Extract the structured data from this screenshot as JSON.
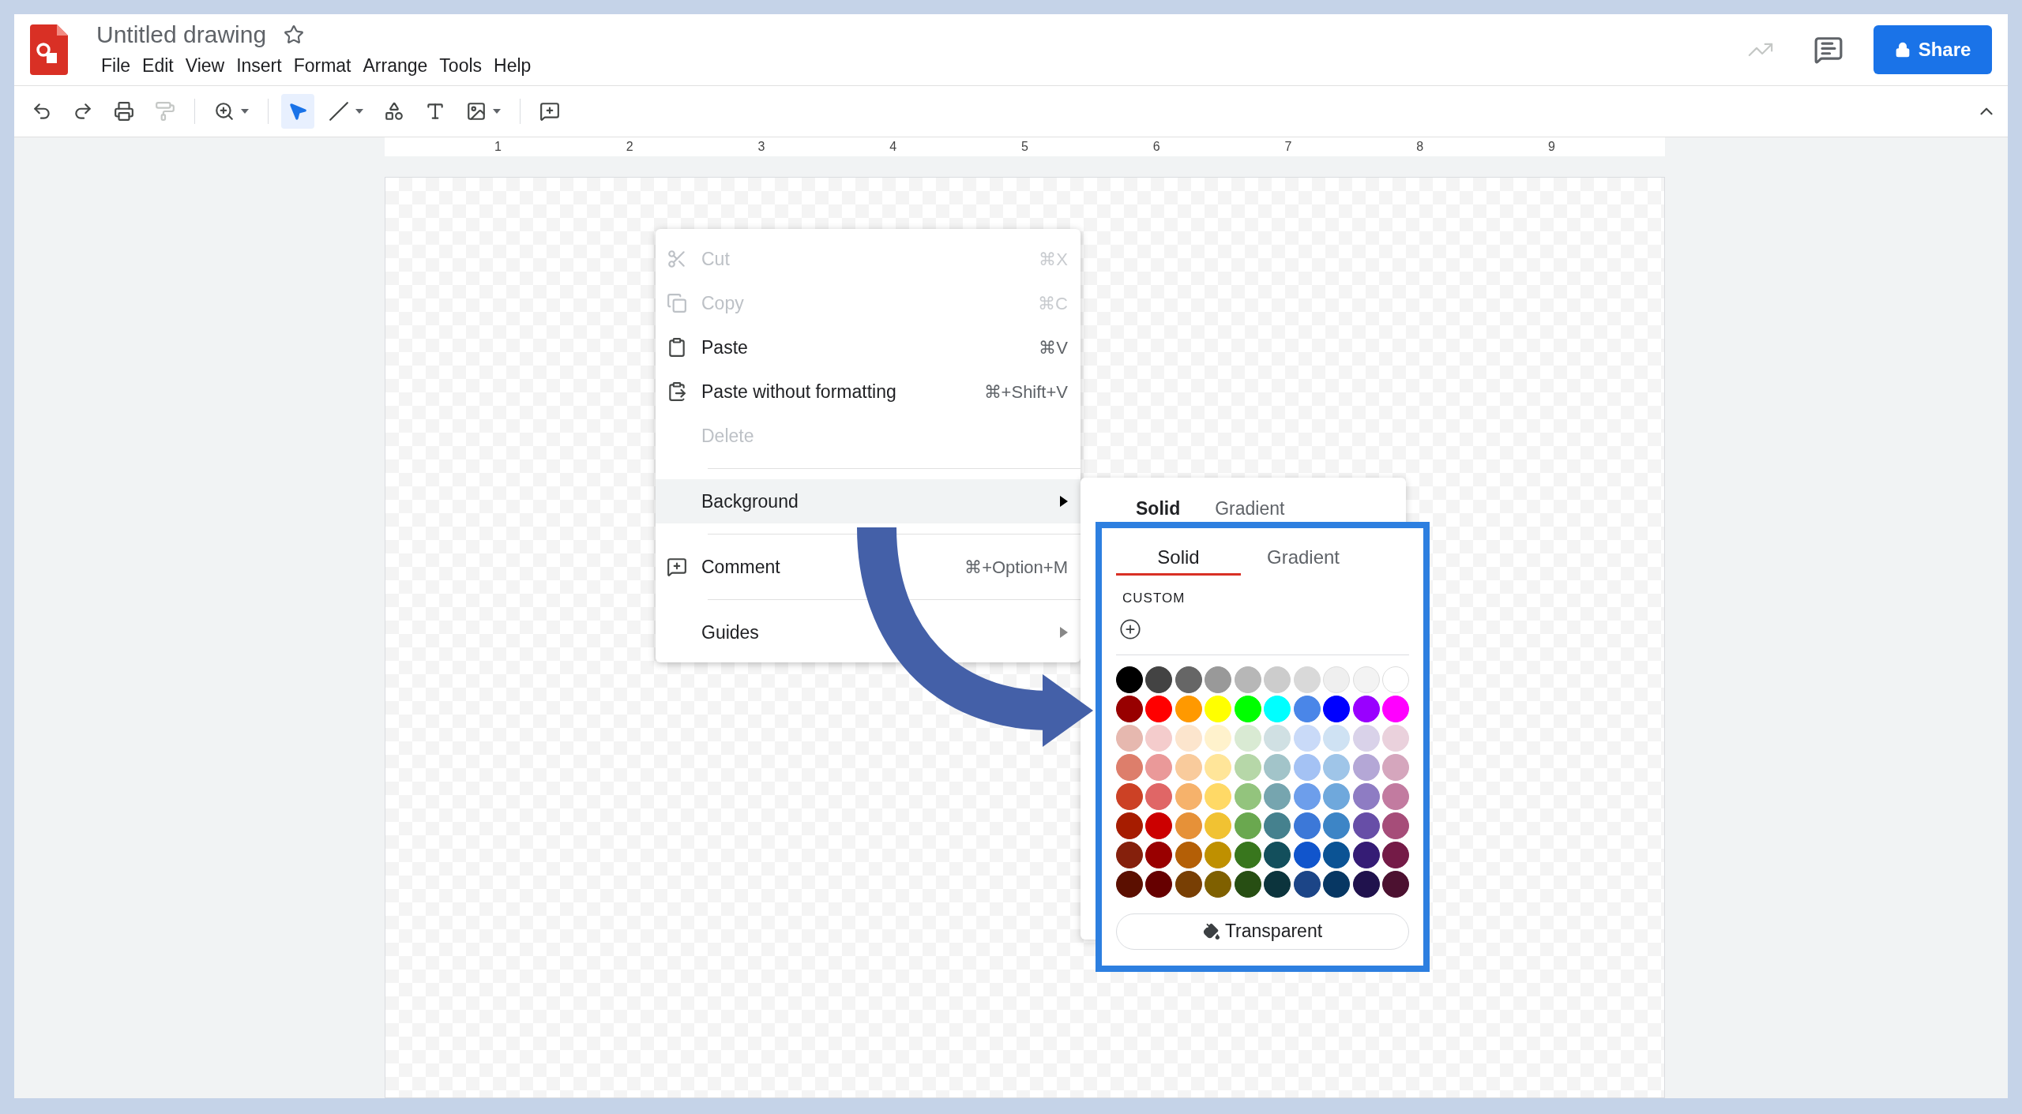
{
  "app": {
    "title": "Untitled drawing",
    "starred": false
  },
  "menu": [
    "File",
    "Edit",
    "View",
    "Insert",
    "Format",
    "Arrange",
    "Tools",
    "Help"
  ],
  "share_button": "Share",
  "toolbar_tools": [
    {
      "selected": false,
      "disabled": false
    },
    {
      "selected": false,
      "disabled": false
    },
    {
      "selected": false,
      "disabled": false
    },
    {
      "selected": false,
      "disabled": true
    },
    {
      "selected": false,
      "disabled": false
    },
    {
      "selected": true,
      "disabled": false
    },
    {
      "selected": false,
      "disabled": false
    },
    {
      "selected": false,
      "disabled": false
    },
    {
      "selected": false,
      "disabled": false
    },
    {
      "selected": false,
      "disabled": false
    },
    {
      "selected": false,
      "disabled": false
    }
  ],
  "ruler": [
    "1",
    "2",
    "3",
    "4",
    "5",
    "6",
    "7",
    "8",
    "9"
  ],
  "context_menu": {
    "items": [
      {
        "label": "Cut",
        "shortcut": "⌘X",
        "disabled": true,
        "selected": false,
        "submenu": false,
        "separator_above": false
      },
      {
        "label": "Copy",
        "shortcut": "⌘C",
        "disabled": true,
        "selected": false,
        "submenu": false,
        "separator_above": false
      },
      {
        "label": "Paste",
        "shortcut": "⌘V",
        "disabled": false,
        "selected": false,
        "submenu": false,
        "separator_above": false
      },
      {
        "label": "Paste without formatting",
        "shortcut": "⌘+Shift+V",
        "disabled": false,
        "selected": false,
        "submenu": false,
        "separator_above": false
      },
      {
        "label": "Delete",
        "disabled": true,
        "selected": false,
        "submenu": false,
        "separator_above": false
      },
      {
        "label": "Background",
        "disabled": false,
        "selected": true,
        "submenu": true,
        "separator_above": true
      },
      {
        "label": "Comment",
        "shortcut": "⌘+Option+M",
        "disabled": false,
        "selected": false,
        "submenu": false,
        "separator_above": true
      },
      {
        "label": "Guides",
        "disabled": false,
        "selected": false,
        "submenu": true,
        "separator_above": true
      }
    ]
  },
  "background_submenu": {
    "tabs": [
      {
        "label": "Solid",
        "selected": true
      },
      {
        "label": "Gradient",
        "selected": false
      }
    ]
  },
  "palette_zoom": {
    "tabs": [
      {
        "label": "Solid",
        "selected": true
      },
      {
        "label": "Gradient",
        "selected": false
      }
    ],
    "custom_label": "CUSTOM",
    "swatch_rows": [
      [
        {
          "color": "#000000"
        },
        {
          "color": "#434343"
        },
        {
          "color": "#666666"
        },
        {
          "color": "#999999"
        },
        {
          "color": "#b7b7b7"
        },
        {
          "color": "#cccccc"
        },
        {
          "color": "#d9d9d9"
        },
        {
          "color": "#efefef"
        },
        {
          "color": "#f3f3f3"
        },
        {
          "color": "#ffffff"
        }
      ],
      [
        {
          "color": "#980000"
        },
        {
          "color": "#ff0000"
        },
        {
          "color": "#ff9900"
        },
        {
          "color": "#ffff00"
        },
        {
          "color": "#00ff00"
        },
        {
          "color": "#00ffff"
        },
        {
          "color": "#4a86e8"
        },
        {
          "color": "#0000ff"
        },
        {
          "color": "#9900ff"
        },
        {
          "color": "#ff00ff"
        }
      ],
      [
        {
          "color": "#e6b8af"
        },
        {
          "color": "#f4cccc"
        },
        {
          "color": "#fce5cd"
        },
        {
          "color": "#fff2cc"
        },
        {
          "color": "#d9ead3"
        },
        {
          "color": "#d0e0e3"
        },
        {
          "color": "#c9daf8"
        },
        {
          "color": "#cfe2f3"
        },
        {
          "color": "#d9d2e9"
        },
        {
          "color": "#ead1dc"
        }
      ],
      [
        {
          "color": "#dd7e6b"
        },
        {
          "color": "#ea9999"
        },
        {
          "color": "#f9cb9c"
        },
        {
          "color": "#ffe599"
        },
        {
          "color": "#b6d7a8"
        },
        {
          "color": "#a2c4c9"
        },
        {
          "color": "#a4c2f4"
        },
        {
          "color": "#9fc5e8"
        },
        {
          "color": "#b4a7d6"
        },
        {
          "color": "#d5a6bd"
        }
      ],
      [
        {
          "color": "#cc4125"
        },
        {
          "color": "#e06666"
        },
        {
          "color": "#f6b26b"
        },
        {
          "color": "#ffd966"
        },
        {
          "color": "#93c47d"
        },
        {
          "color": "#76a5af"
        },
        {
          "color": "#6d9eeb"
        },
        {
          "color": "#6fa8dc"
        },
        {
          "color": "#8e7cc3"
        },
        {
          "color": "#c27ba0"
        }
      ],
      [
        {
          "color": "#a61c00"
        },
        {
          "color": "#cc0000"
        },
        {
          "color": "#e69138"
        },
        {
          "color": "#f1c232"
        },
        {
          "color": "#6aa84f"
        },
        {
          "color": "#45818e"
        },
        {
          "color": "#3c78d8"
        },
        {
          "color": "#3d85c6"
        },
        {
          "color": "#674ea7"
        },
        {
          "color": "#a64d79"
        }
      ],
      [
        {
          "color": "#85200c"
        },
        {
          "color": "#990000"
        },
        {
          "color": "#b45f06"
        },
        {
          "color": "#bf9000"
        },
        {
          "color": "#38761d"
        },
        {
          "color": "#134f5c"
        },
        {
          "color": "#1155cc"
        },
        {
          "color": "#0b5394"
        },
        {
          "color": "#351c75"
        },
        {
          "color": "#741b47"
        }
      ],
      [
        {
          "color": "#5b0f00"
        },
        {
          "color": "#660000"
        },
        {
          "color": "#783f04"
        },
        {
          "color": "#7f6000"
        },
        {
          "color": "#274e13"
        },
        {
          "color": "#0c343d"
        },
        {
          "color": "#1c4587"
        },
        {
          "color": "#073763"
        },
        {
          "color": "#20124d"
        },
        {
          "color": "#4c1130"
        }
      ]
    ],
    "transparent_button": "Transparent"
  }
}
